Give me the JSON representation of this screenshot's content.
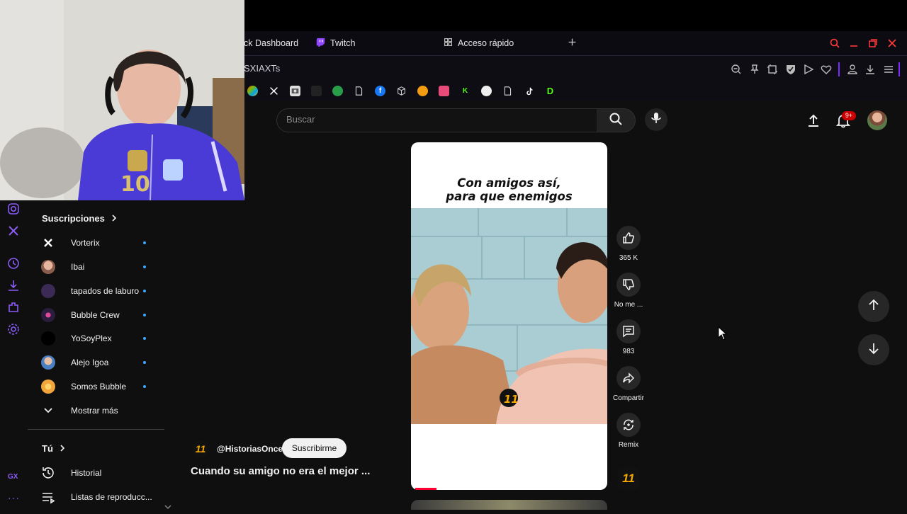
{
  "browser": {
    "tabs": [
      {
        "label": "ck Dashboard"
      },
      {
        "label": "Twitch"
      },
      {
        "label": "Acceso rápido"
      }
    ],
    "address": "SXIAXTs",
    "bookmark_labels": [
      "D"
    ]
  },
  "colors": {
    "accent": "#3ea6ff",
    "brand_red": "#ff0033",
    "opera_red": "#ff3b3b",
    "twitch": "#9146ff",
    "historias_orange": "#f5a800"
  },
  "youtube": {
    "search_placeholder": "Buscar",
    "notifications_badge": "9+",
    "sidebar": {
      "subscriptions_title": "Suscripciones",
      "subscriptions": [
        {
          "name": "Vorterix",
          "color": "#0f0f0f"
        },
        {
          "name": "Ibai",
          "color": "#c98a7a"
        },
        {
          "name": "tapados de laburo",
          "color": "#3a2a55"
        },
        {
          "name": "Bubble Crew",
          "color": "#2a1d3d"
        },
        {
          "name": "YoSoyPlex",
          "color": "#000000"
        },
        {
          "name": "Alejo Igoa",
          "color": "#4a7fc1"
        },
        {
          "name": "Somos Bubble",
          "color": "#f2a53a"
        }
      ],
      "show_more": "Mostrar más",
      "you_title": "Tú",
      "history": "Historial",
      "playlists": "Listas de reproducc..."
    },
    "short": {
      "caption_line1": "Con amigos así,",
      "caption_line2": "para que enemigos",
      "channel_handle": "@HistoriasOnce",
      "subscribe_label": "Suscribirme",
      "title": "Cuando su amigo no era el mejor  ...",
      "progress_fraction": 0.11,
      "actions": {
        "likes": "365 K",
        "dislike": "No me ...",
        "comments": "983",
        "share": "Compartir",
        "remix": "Remix"
      }
    }
  },
  "gx_sidebar": {
    "gx_label": "GX"
  }
}
